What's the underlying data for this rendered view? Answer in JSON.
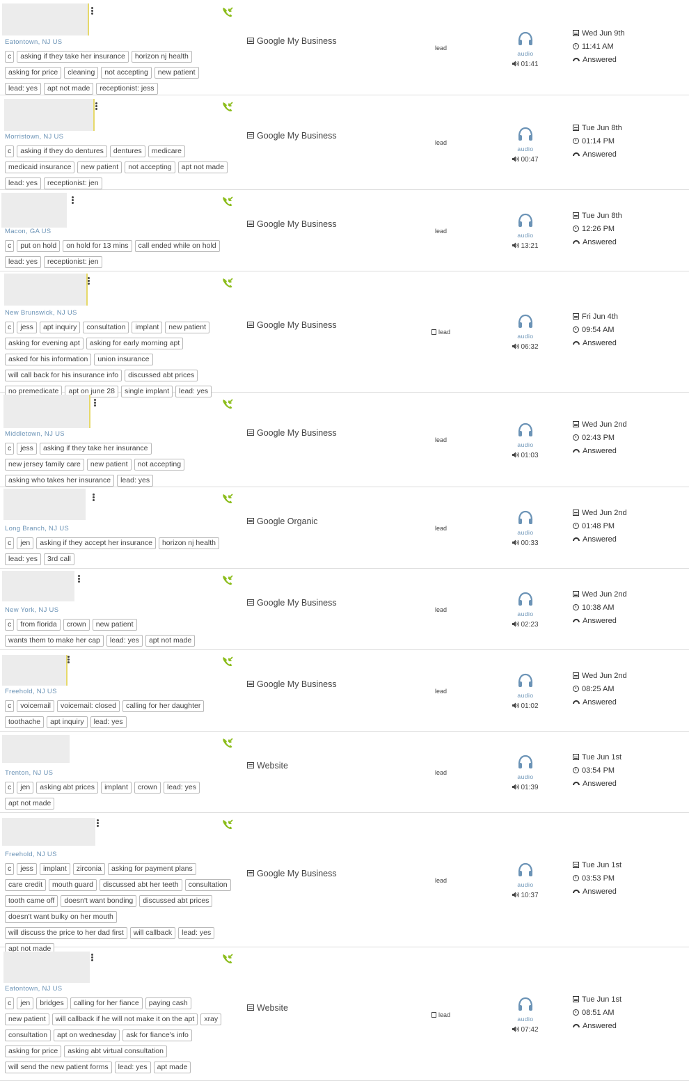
{
  "colors": {
    "accent_green": "#8cbd1c",
    "audio_blue": "#6b93b6",
    "thumb_highlight": "#e6d96a"
  },
  "icons": {
    "call_type": "incoming-call-icon",
    "source": "source-list-icon",
    "audio": "headphones-icon",
    "volume": "speaker-icon",
    "date": "calendar-icon",
    "time": "clock-icon",
    "status": "hang-up-icon",
    "menu": "more-vertical-icon"
  },
  "calls": [
    {
      "location": "Eatontown, NJ US",
      "tags": [
        "c",
        "asking if they take her insurance",
        "horizon nj health",
        "asking for price",
        "cleaning",
        "not accepting",
        "new patient",
        "lead: yes",
        "apt not made",
        "receptionist: jess"
      ],
      "source": "Google My Business",
      "lead": "lead",
      "audio_label": "audio",
      "duration": "01:41",
      "date": "Wed Jun 9th",
      "time": "11:41 AM",
      "status": "Answered"
    },
    {
      "location": "Morristown, NJ US",
      "tags": [
        "c",
        "asking if they do dentures",
        "dentures",
        "medicare",
        "medicaid insurance",
        "new patient",
        "not accepting",
        "apt not made",
        "lead: yes",
        "receptionist: jen"
      ],
      "source": "Google My Business",
      "lead": "lead",
      "audio_label": "audio",
      "duration": "00:47",
      "date": "Tue Jun 8th",
      "time": "01:14 PM",
      "status": "Answered"
    },
    {
      "location": "Macon, GA US",
      "tags": [
        "c",
        "put on hold",
        "on hold for 13 mins",
        "call ended while on hold",
        "lead: yes",
        "receptionist: jen"
      ],
      "source": "Google My Business",
      "lead": "lead",
      "audio_label": "audio",
      "duration": "13:21",
      "date": "Tue Jun 8th",
      "time": "12:26 PM",
      "status": "Answered"
    },
    {
      "location": "New Brunswick, NJ US",
      "tags": [
        "c",
        "jess",
        "apt inquiry",
        "consultation",
        "implant",
        "new patient",
        "asking for evening apt",
        "asking for early morning apt",
        "asked for his information",
        "union insurance",
        "will call back for his insurance info",
        "discussed abt prices",
        "no premedicate",
        "apt on june 28",
        "single implant",
        "lead: yes"
      ],
      "source": "Google My Business",
      "lead": "lead",
      "audio_label": "audio",
      "duration": "06:32",
      "date": "Fri Jun 4th",
      "time": "09:54 AM",
      "status": "Answered"
    },
    {
      "location": "Middletown, NJ US",
      "tags": [
        "c",
        "jess",
        "asking if they take her insurance",
        "new jersey family care",
        "new patient",
        "not accepting",
        "asking who takes her insurance",
        "lead: yes"
      ],
      "source": "Google My Business",
      "lead": "lead",
      "audio_label": "audio",
      "duration": "01:03",
      "date": "Wed Jun 2nd",
      "time": "02:43 PM",
      "status": "Answered"
    },
    {
      "location": "Long Branch, NJ US",
      "tags": [
        "c",
        "jen",
        "asking if they accept her insurance",
        "horizon nj health",
        "lead: yes",
        "3rd call"
      ],
      "source": "Google Organic",
      "lead": "lead",
      "audio_label": "audio",
      "duration": "00:33",
      "date": "Wed Jun 2nd",
      "time": "01:48 PM",
      "status": "Answered"
    },
    {
      "location": "New York, NJ US",
      "tags": [
        "c",
        "from florida",
        "crown",
        "new patient",
        "wants them to make her cap",
        "lead: yes",
        "apt not made"
      ],
      "source": "Google My Business",
      "lead": "lead",
      "audio_label": "audio",
      "duration": "02:23",
      "date": "Wed Jun 2nd",
      "time": "10:38 AM",
      "status": "Answered"
    },
    {
      "location": "Freehold, NJ US",
      "tags": [
        "c",
        "voicemail",
        "voicemail: closed",
        "calling for her daughter",
        "toothache",
        "apt inquiry",
        "lead: yes"
      ],
      "source": "Google My Business",
      "lead": "lead",
      "audio_label": "audio",
      "duration": "01:02",
      "date": "Wed Jun 2nd",
      "time": "08:25 AM",
      "status": "Answered"
    },
    {
      "location": "Trenton, NJ US",
      "tags": [
        "c",
        "jen",
        "asking abt prices",
        "implant",
        "crown",
        "lead: yes",
        "apt not made"
      ],
      "source": "Website",
      "lead": "lead",
      "audio_label": "audio",
      "duration": "01:39",
      "date": "Tue Jun 1st",
      "time": "03:54 PM",
      "status": "Answered"
    },
    {
      "location": "Freehold, NJ US",
      "tags": [
        "c",
        "jess",
        "implant",
        "zirconia",
        "asking for payment plans",
        "care credit",
        "mouth guard",
        "discussed abt her teeth",
        "consultation",
        "tooth came off",
        "doesn't want bonding",
        "discussed abt prices",
        "doesn't want bulky on her mouth",
        "will discuss the price to her dad first",
        "will callback",
        "lead: yes",
        "apt not made"
      ],
      "source": "Google My Business",
      "lead": "lead",
      "audio_label": "audio",
      "duration": "10:37",
      "date": "Tue Jun 1st",
      "time": "03:53 PM",
      "status": "Answered"
    },
    {
      "location": "Eatontown, NJ US",
      "tags": [
        "c",
        "jen",
        "bridges",
        "calling for her fiance",
        "paying cash",
        "new patient",
        "will callback if he will not make it on the apt",
        "xray",
        "consultation",
        "apt on wednesday",
        "ask for fiance's info",
        "asking for price",
        "asking abt virtual consultation",
        "will send the new patient forms",
        "lead: yes",
        "apt made"
      ],
      "source": "Website",
      "lead": "lead",
      "audio_label": "audio",
      "duration": "07:42",
      "date": "Tue Jun 1st",
      "time": "08:51 AM",
      "status": "Answered"
    }
  ]
}
